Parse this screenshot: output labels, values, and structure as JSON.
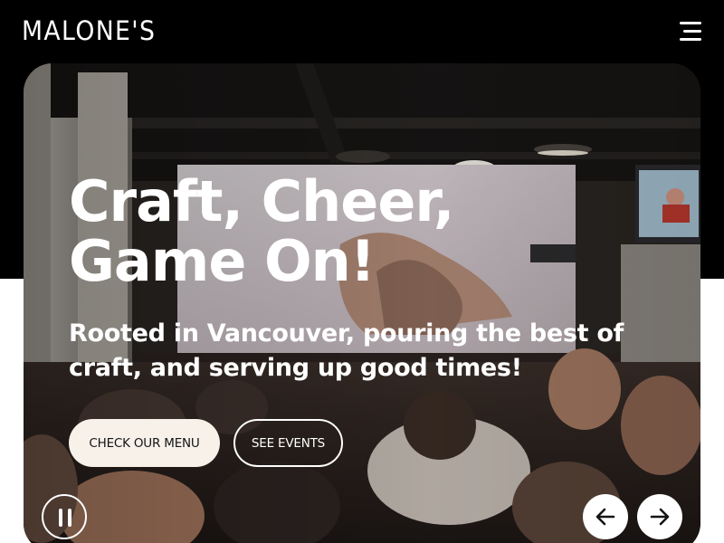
{
  "header": {
    "logo_text": "MALONE'S",
    "menu_icon": "hamburger-menu-icon"
  },
  "hero": {
    "headline": "Craft, Cheer, Game On!",
    "subheadline": "Rooted in Vancouver, pouring the best of craft, and serving up good times!",
    "primary_button": "CHECK OUR MENU",
    "secondary_button": "SEE EVENTS",
    "pause_icon": "pause-icon",
    "prev_icon": "arrow-left-icon",
    "next_icon": "arrow-right-icon",
    "background": "photo of a crowded pub with a large projection screen showing a fight"
  },
  "colors": {
    "page_background": "#000000",
    "primary_button_bg": "#f7f1ea",
    "text": "#ffffff"
  }
}
